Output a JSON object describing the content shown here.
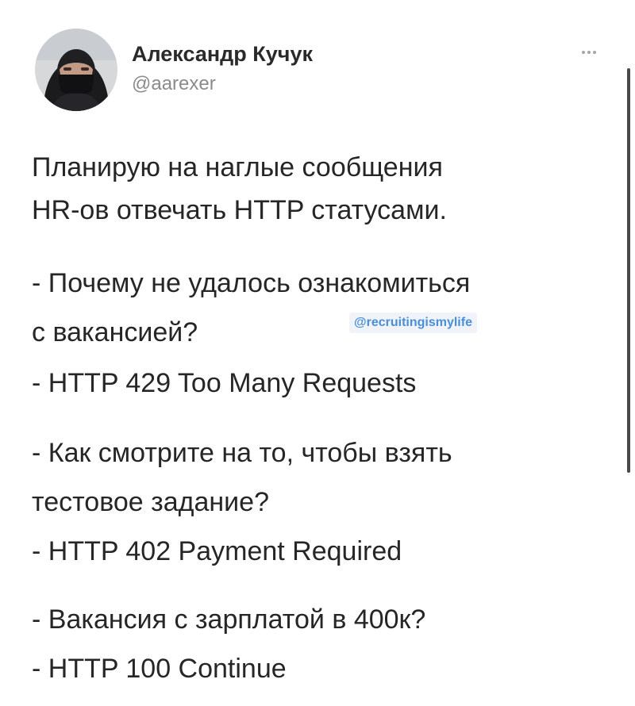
{
  "author": {
    "name": "Александр Кучук",
    "handle": "@aarexer"
  },
  "tweet": {
    "lines": [
      "Планирую на наглые сообщения",
      "HR-ов отвечать HTTP статусами.",
      "- Почему не удалось ознакомиться",
      "с вакансией?",
      "- HTTP 429 Too Many Requests",
      "- Как смотрите на то, чтобы взять",
      "тестовое задание?",
      "- HTTP 402 Payment Required",
      "- Вакансия с зарплатой в 400к?",
      "- HTTP 100 Continue"
    ]
  },
  "watermark": "@recruitingismylife",
  "colors": {
    "text": "#262626",
    "handle": "#8b8b8b",
    "watermark": "#4a8fd9"
  }
}
